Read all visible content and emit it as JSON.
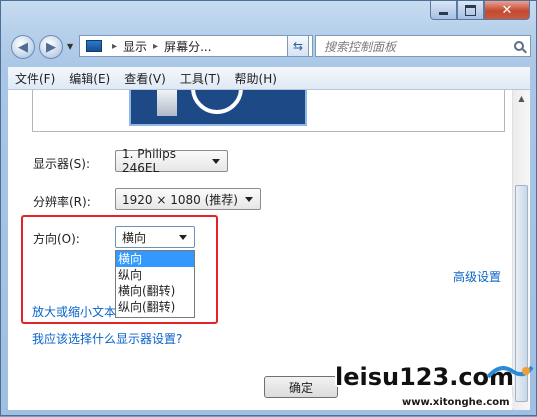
{
  "window": {
    "caption": {
      "minimize_icon": "minimize-icon",
      "maximize_icon": "maximize-icon",
      "close_icon": "close-icon"
    }
  },
  "nav": {
    "back_icon": "back-arrow-icon",
    "forward_icon": "forward-arrow-icon",
    "address": {
      "segment1": "显示",
      "separator": "▸",
      "segment2": "屏幕分...",
      "dropdown_icon": "chevron-down-icon"
    },
    "refresh_icon": "refresh-icon",
    "search": {
      "placeholder": "搜索控制面板",
      "icon": "search-icon"
    }
  },
  "menubar": {
    "items": [
      "文件(F)",
      "编辑(E)",
      "查看(V)",
      "工具(T)",
      "帮助(H)"
    ]
  },
  "settings": {
    "display_label": "显示器(S):",
    "display_value": "1. Philips 246EL",
    "resolution_label": "分辨率(R):",
    "resolution_value": "1920 × 1080 (推荐)",
    "orientation_label": "方向(O):",
    "orientation_value": "横向",
    "orientation_options": [
      "横向",
      "纵向",
      "横向(翻转)",
      "纵向(翻转)"
    ],
    "selected_option_index": 0
  },
  "links": {
    "advanced": "高级设置",
    "resize_text": "放大或缩小文本",
    "which_settings": "我应该选择什么显示器设置?"
  },
  "buttons": {
    "ok": "确定"
  },
  "watermark": {
    "main": "leisu123.com",
    "sub": "www.xitonghe.com"
  },
  "colors": {
    "accent_link": "#0a63c9",
    "highlight_box": "#e32326",
    "selection": "#3399ff"
  }
}
